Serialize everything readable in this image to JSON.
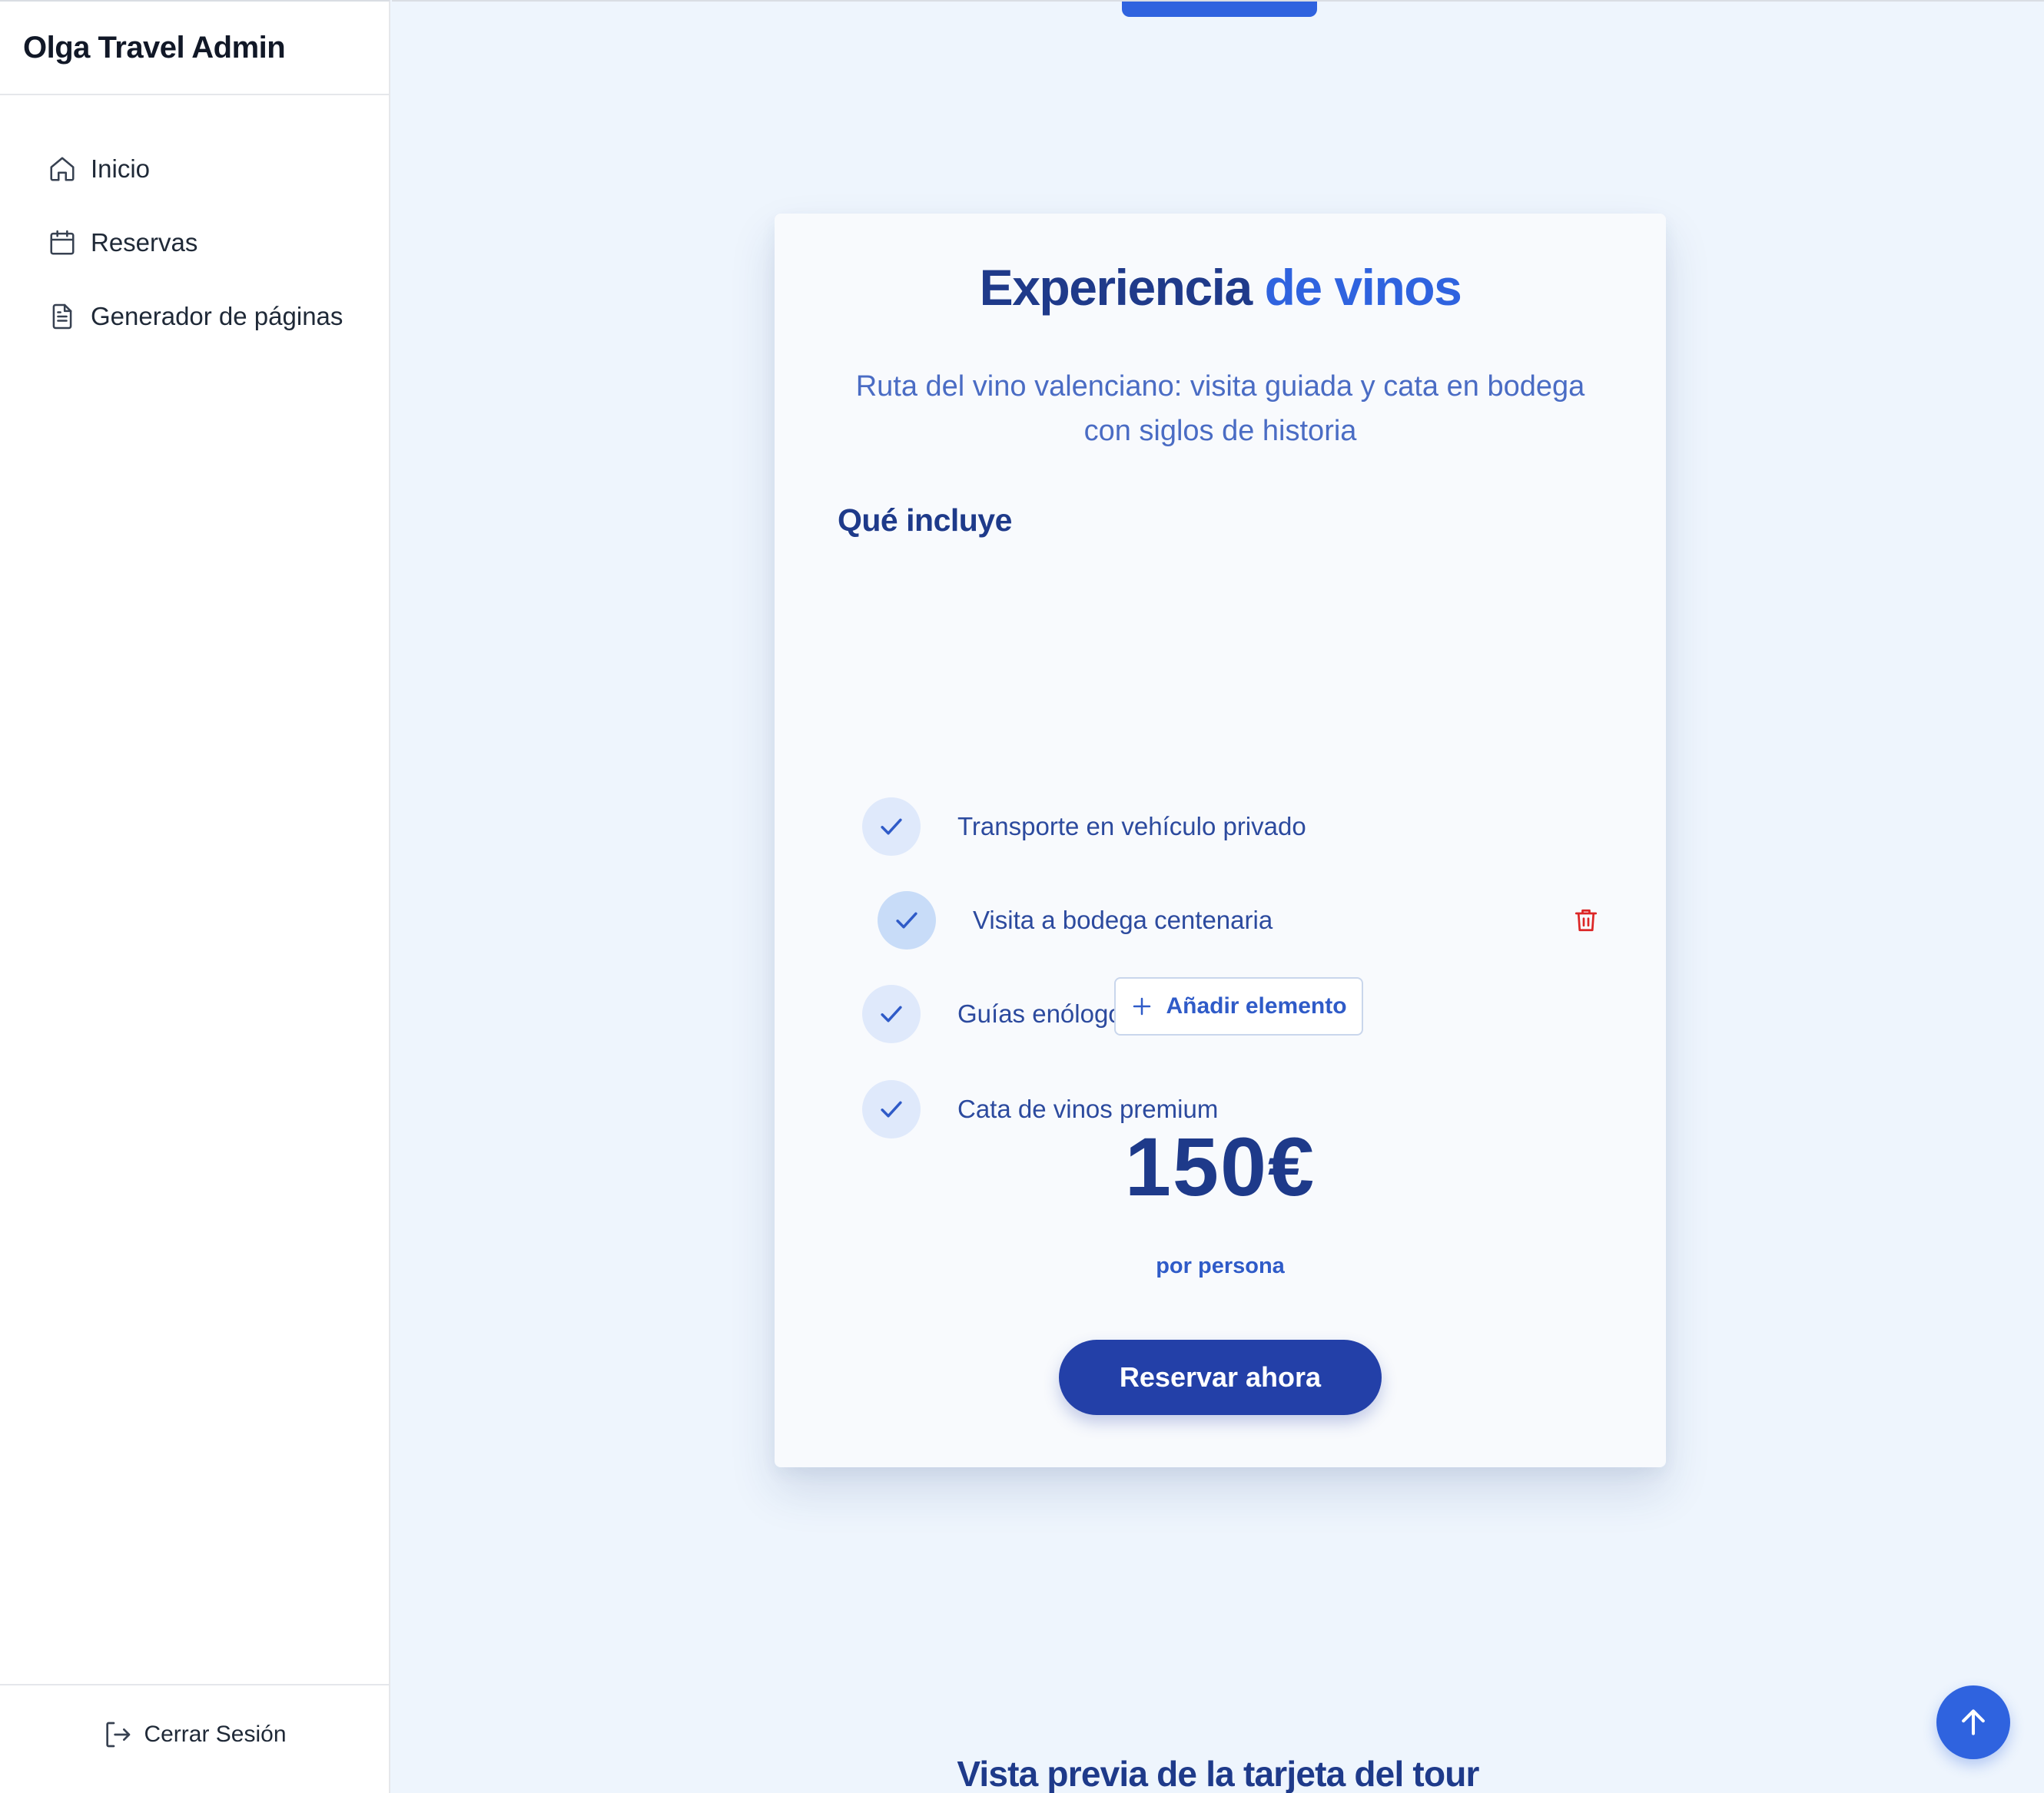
{
  "app": {
    "title": "Olga Travel Admin"
  },
  "sidebar": {
    "items": [
      {
        "label": "Inicio",
        "icon": "home-icon"
      },
      {
        "label": "Reservas",
        "icon": "calendar-icon"
      },
      {
        "label": "Generador de páginas",
        "icon": "document-icon"
      }
    ],
    "logout_label": "Cerrar Sesión"
  },
  "card": {
    "title_part1": "Experiencia",
    "title_part2": "de vinos",
    "subtitle": "Ruta del vino valenciano: visita guiada y cata en bodega con siglos de historia",
    "includes_heading": "Qué incluye",
    "includes": [
      {
        "text": "Transporte en vehículo privado"
      },
      {
        "text": "Visita a bodega centenaria"
      },
      {
        "text": "Guías enólogos expertos"
      },
      {
        "text": "Cata de vinos premium"
      }
    ],
    "add_label": "Añadir elemento",
    "price": "150€",
    "price_note": "por persona",
    "book_label": "Reservar ahora"
  },
  "preview_heading": "Vista previa de la tarjeta del tour",
  "colors": {
    "accent": "#2f63df",
    "primary_dark": "#1e3a8a",
    "button": "#2340a8",
    "danger": "#dc2626"
  }
}
